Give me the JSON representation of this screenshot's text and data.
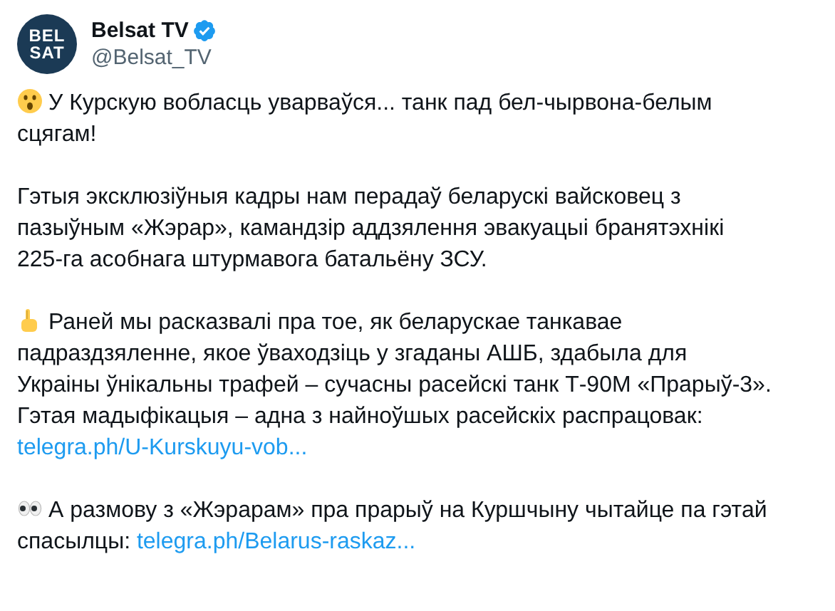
{
  "account": {
    "logo_top": "BEL",
    "logo_bottom": "SAT",
    "name": "Belsat TV",
    "verified": true,
    "handle": "@Belsat_TV"
  },
  "paragraphs": [
    {
      "kind": "surprised",
      "segments": [
        {
          "kind": "text",
          "text": "У Курскую вобласць уварваўся... танк пад бел-чырвона-белым сцягам!"
        }
      ]
    },
    {
      "kind": "plain",
      "segments": [
        {
          "kind": "text",
          "text": "Гэтыя эксклюзіўныя кадры нам перадаў беларускі вайсковец з пазыўным «Жэрар», камандзір аддзялення эвакуацыі бранятэхнікі 225-га асобнага штурмавога батальёну ЗСУ."
        }
      ]
    },
    {
      "kind": "pointing",
      "segments": [
        {
          "kind": "text",
          "text": "Раней мы расказвалі пра тое, як беларускае танкавае падраздзяленне, якое ўваходзіць у згаданы АШБ, здабыла для Украіны ўнікальны трафей – сучасны расейскі танк Т-90М «Прарыў-3». Гэтая мадыфікацыя – адна з найноўшых расейскіх распрацовак: "
        },
        {
          "kind": "link",
          "text": "telegra.ph/U-Kurskuyu-vob..."
        }
      ]
    },
    {
      "kind": "eyes",
      "segments": [
        {
          "kind": "text",
          "text": "А размову з «Жэрарам» пра прарыў на Куршчыну чытайце па гэтай спасылцы: "
        },
        {
          "kind": "link",
          "text": "telegra.ph/Belarus-raskaz..."
        }
      ]
    }
  ]
}
